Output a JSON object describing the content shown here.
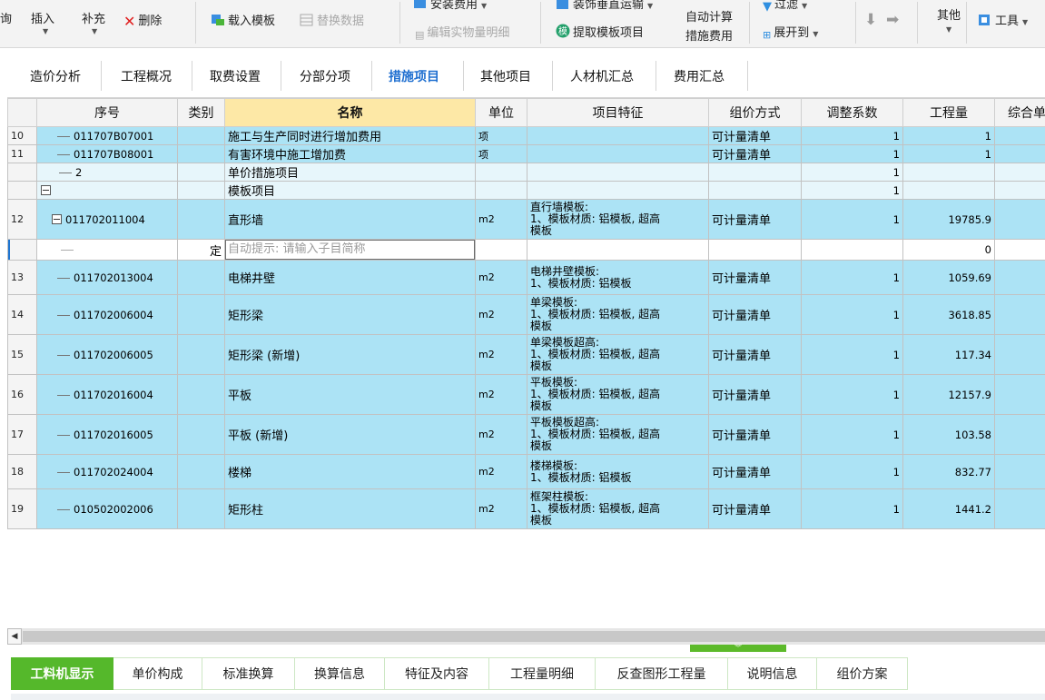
{
  "toolbar": {
    "query": "询",
    "insert": "插入",
    "supplement": "补充",
    "delete": "删除",
    "load_template": "载入模板",
    "replace_data": "替换数据",
    "install_fee": "安装费用",
    "edit_quantity_detail": "编辑实物量明细",
    "decoration_transport": "装饰垂直运输",
    "extract_template": "提取模板项目",
    "auto_calc_line1": "自动计算",
    "auto_calc_line2": "措施费用",
    "filter": "过滤",
    "expand_to": "展开到",
    "other": "其他",
    "tools": "工具"
  },
  "tabs": [
    "造价分析",
    "工程概况",
    "取费设置",
    "分部分项",
    "措施项目",
    "其他项目",
    "人材机汇总",
    "费用汇总"
  ],
  "active_tab": "措施项目",
  "table": {
    "headers": [
      "序号",
      "类别",
      "名称",
      "单位",
      "项目特征",
      "组价方式",
      "调整系数",
      "工程量",
      "综合单"
    ],
    "rows": [
      {
        "rn": "10",
        "code": "011707B07001",
        "type": "",
        "name": "施工与生产同时进行增加费用",
        "unit": "项",
        "feature": "",
        "method": "可计量清单",
        "coef": "1",
        "qty": "1",
        "style": "blue"
      },
      {
        "rn": "11",
        "code": "011707B08001",
        "type": "",
        "name": "有害环境中施工增加费",
        "unit": "项",
        "feature": "",
        "method": "可计量清单",
        "coef": "1",
        "qty": "1",
        "style": "blue"
      },
      {
        "rn": "",
        "code": "2",
        "type": "",
        "name": "单价措施项目",
        "unit": "",
        "feature": "",
        "method": "",
        "coef": "1",
        "qty": "",
        "style": "light"
      },
      {
        "rn": "",
        "code": "",
        "type": "",
        "name": "模板项目",
        "unit": "",
        "feature": "",
        "method": "",
        "coef": "1",
        "qty": "",
        "style": "light"
      },
      {
        "rn": "12",
        "code": "011702011004",
        "type": "",
        "name": "直形墙",
        "unit": "m2",
        "feature": "直行墙模板:\n1、模板材质: 铝模板, 超高\n模板",
        "method": "可计量清单",
        "coef": "1",
        "qty": "19785.9",
        "style": "blue"
      },
      {
        "rn": "",
        "code": "",
        "type": "定",
        "name": "",
        "unit": "",
        "feature": "",
        "method": "",
        "coef": "",
        "qty": "0",
        "style": "edit"
      },
      {
        "rn": "13",
        "code": "011702013004",
        "type": "",
        "name": "电梯井壁",
        "unit": "m2",
        "feature": "电梯井壁模板:\n1、模板材质: 铝模板",
        "method": "可计量清单",
        "coef": "1",
        "qty": "1059.69",
        "style": "blue"
      },
      {
        "rn": "14",
        "code": "011702006004",
        "type": "",
        "name": "矩形梁",
        "unit": "m2",
        "feature": "单梁模板:\n1、模板材质: 铝模板, 超高\n模板",
        "method": "可计量清单",
        "coef": "1",
        "qty": "3618.85",
        "style": "blue"
      },
      {
        "rn": "15",
        "code": "011702006005",
        "type": "",
        "name": "矩形梁 (新增)",
        "unit": "m2",
        "feature": "单梁模板超高:\n1、模板材质: 铝模板, 超高\n模板",
        "method": "可计量清单",
        "coef": "1",
        "qty": "117.34",
        "style": "blue"
      },
      {
        "rn": "16",
        "code": "011702016004",
        "type": "",
        "name": "平板",
        "unit": "m2",
        "feature": "平板模板:\n1、模板材质: 铝模板, 超高\n模板",
        "method": "可计量清单",
        "coef": "1",
        "qty": "12157.9",
        "style": "blue"
      },
      {
        "rn": "17",
        "code": "011702016005",
        "type": "",
        "name": "平板 (新增)",
        "unit": "m2",
        "feature": "平板模板超高:\n1、模板材质: 铝模板, 超高\n模板",
        "method": "可计量清单",
        "coef": "1",
        "qty": "103.58",
        "style": "blue"
      },
      {
        "rn": "18",
        "code": "011702024004",
        "type": "",
        "name": "楼梯",
        "unit": "m2",
        "feature": "楼梯模板:\n1、模板材质: 铝模板",
        "method": "可计量清单",
        "coef": "1",
        "qty": "832.77",
        "style": "blue"
      },
      {
        "rn": "19",
        "code": "010502002006",
        "type": "",
        "name": "矩形柱",
        "unit": "m2",
        "feature": "框架柱模板:\n1、模板材质: 铝模板, 超高\n模板",
        "method": "可计量清单",
        "coef": "1",
        "qty": "1441.2",
        "style": "blue"
      }
    ]
  },
  "edit_placeholder": "自动提示: 请输入子目简称",
  "bottom_tabs": [
    "工料机显示",
    "单价构成",
    "标准换算",
    "换算信息",
    "特征及内容",
    "工程量明细",
    "反查图形工程量",
    "说明信息",
    "组价方案"
  ],
  "bottom_active": "工料机显示",
  "colors": {
    "row_blue": "#ace3f5",
    "header_highlight": "#fde8a6",
    "active_tab_text": "#1f6fd0",
    "bottom_active": "#55b82b"
  }
}
